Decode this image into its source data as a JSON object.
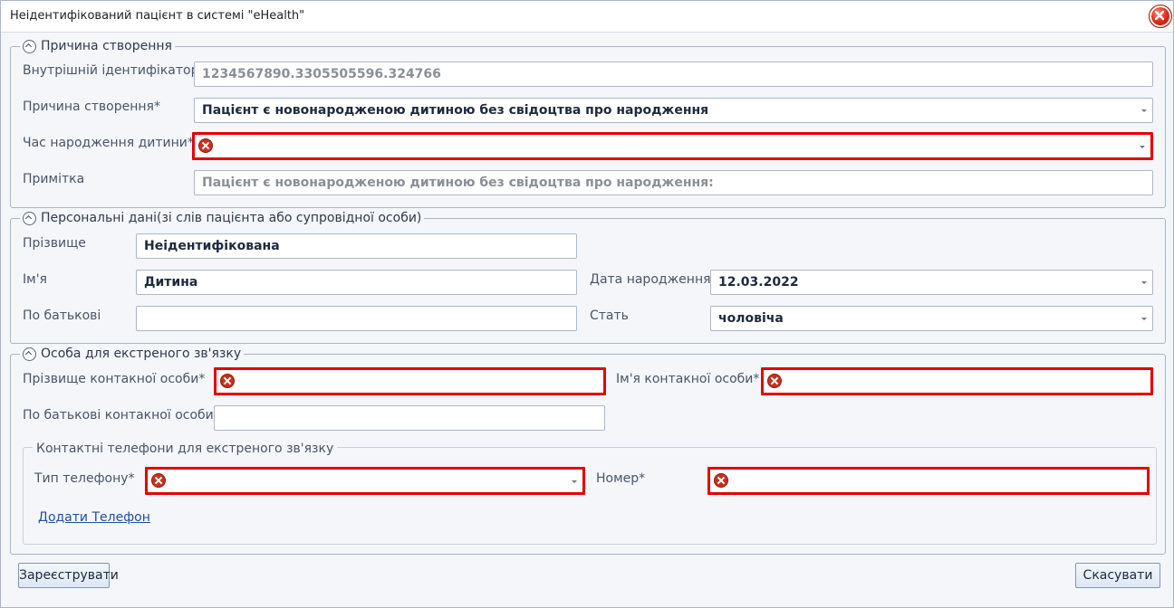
{
  "window": {
    "title": "Неідентифікований пацієнт в системі \"eHealth\""
  },
  "reason_group": {
    "legend": "Причина створення",
    "internal_id_label": "Внутрішній ідентифікатор",
    "internal_id_value": "1234567890.3305505596.324766",
    "reason_label": "Причина створення*",
    "reason_value": "Пацієнт є новонародженою дитиною без свідоцтва про народження",
    "birth_time_label": "Час народження дитини*",
    "birth_time_value": "",
    "note_label": "Примітка",
    "note_value": "Пацієнт є новонародженою дитиною без свідоцтва про народження:"
  },
  "personal_group": {
    "legend": "Персональні дані(зі слів пацієнта або супровідної особи)",
    "surname_label": "Прізвище",
    "surname_value": "Неідентифікована",
    "name_label": "Ім'я",
    "name_value": "Дитина",
    "patronymic_label": "По батькові",
    "patronymic_value": "",
    "birthdate_label": "Дата народження",
    "birthdate_value": "12.03.2022",
    "sex_label": "Стать",
    "sex_value": "чоловіча"
  },
  "emergency_group": {
    "legend": "Особа для екстреного зв'язку",
    "contact_surname_label": "Прізвище контакної особи*",
    "contact_surname_value": "",
    "contact_name_label": "Ім'я контакної особи*",
    "contact_name_value": "",
    "contact_patronymic_label": "По батькові контакної особи",
    "contact_patronymic_value": "",
    "phones": {
      "title": "Контактні телефони для екстреного зв'язку",
      "type_label": "Тип телефону*",
      "type_value": "",
      "number_label": "Номер*",
      "number_value": "",
      "add_link": "Додати Телефон"
    }
  },
  "buttons": {
    "register": "Зареєструвати",
    "cancel": "Скасувати"
  },
  "colors": {
    "error_border": "#e30000",
    "field_border": "#abb8c9",
    "background": "#f4f6fa"
  },
  "icons": {
    "close": "close-icon",
    "collapse": "chevron-up-icon",
    "error": "error-icon",
    "dropdown": "dropdown-arrow-icon"
  }
}
